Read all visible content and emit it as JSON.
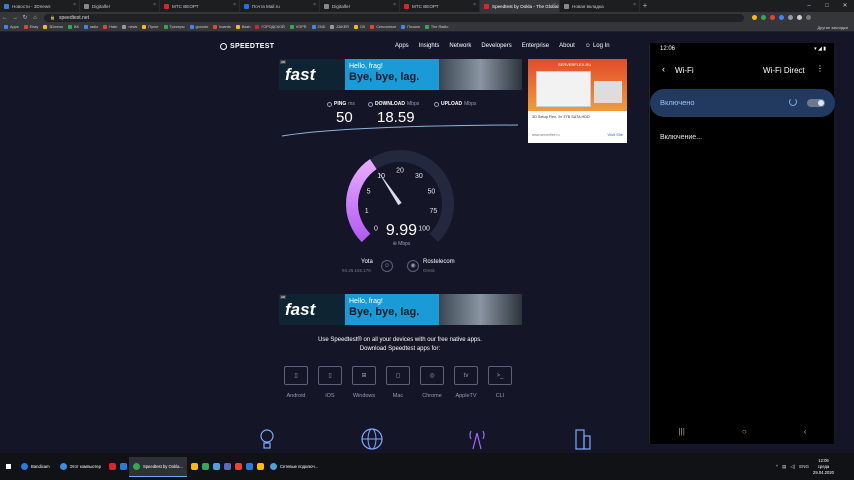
{
  "browser": {
    "tabs": [
      {
        "title": "Новости - 3Dnews",
        "color": "#3a7bd5"
      },
      {
        "title": "Digitalfer",
        "color": "#888888"
      },
      {
        "title": "МТС ВЕОРТ",
        "color": "#d9262c"
      },
      {
        "title": "Почта Mail.ru",
        "color": "#1a73e8"
      },
      {
        "title": "Digitalfer",
        "color": "#888888"
      },
      {
        "title": "МТС ВЕОРТ",
        "color": "#d9262c"
      },
      {
        "title": "Speedtest by Ookla - The Global...",
        "color": "#d9262c",
        "active": true
      },
      {
        "title": "Новая вкладка",
        "color": "#888888"
      }
    ],
    "new_tab": "+",
    "window_controls": [
      "–",
      "□",
      "✕"
    ],
    "url": "speedtest.net",
    "bookmarks": [
      "Apps",
      "Ebay",
      "3Dnews",
      "ВК",
      "radio",
      "Habr",
      "news",
      "Пульт",
      "Трекеры",
      "gooodo",
      "boards",
      "Bash",
      "ГОРОДСКОЙ",
      "VOPR",
      "ZND",
      "ZAKER",
      "ОК",
      "Сенсонные",
      "Почкин",
      "The Radio"
    ],
    "bookmark_colors": [
      "#4285f4",
      "#ea4335",
      "#fbbc05",
      "#34a853",
      "#4285f4",
      "#ea4335",
      "#999999",
      "#fbbc05",
      "#34a853",
      "#4285f4",
      "#ea4335",
      "#fbbc05",
      "#d9262c",
      "#34a853",
      "#4285f4",
      "#999999",
      "#fbbc05",
      "#ea4335",
      "#4285f4",
      "#34a853"
    ],
    "other_bookmarks": "Другие закладки"
  },
  "speedtest": {
    "logo": "SPEEDTEST",
    "nav": [
      "Apps",
      "Insights",
      "Network",
      "Developers",
      "Enterprise",
      "About"
    ],
    "login": "Log In",
    "ad": {
      "tag": "AD",
      "brand": "fast",
      "hello": "Hello, frag!",
      "bye": "Bye, bye, lag."
    },
    "side_ad": {
      "brand": "SERVERFLEX.RU",
      "title": "3D Setup Flex. 2x 3TB SATA HDD",
      "url": "www.serverflex.ru",
      "visit": "Visit Site"
    },
    "ping": {
      "label": "PING",
      "unit": "ms",
      "value": "50"
    },
    "download": {
      "label": "DOWNLOAD",
      "unit": "Mbps",
      "value": "18.59"
    },
    "upload": {
      "label": "UPLOAD",
      "unit": "Mbps",
      "value": ""
    },
    "gauge_labels": [
      "0",
      "1",
      "5",
      "10",
      "20",
      "30",
      "50",
      "75",
      "100"
    ],
    "gauge_value": 9.99,
    "current_speed": "9.99",
    "speed_unit": "Mbps",
    "isp": {
      "name": "Yota",
      "ip": "94.25.165.176"
    },
    "server": {
      "name": "Rostelecom",
      "city": "Omsk"
    },
    "apps_line1": "Use Speedtest® on all your devices with our free native apps.",
    "apps_line2": "Download Speedtest apps for:",
    "apps": [
      "Android",
      "iOS",
      "Windows",
      "Mac",
      "Chrome",
      "AppleTV",
      "CLI"
    ]
  },
  "phone": {
    "time": "12:06",
    "status_right": "▾ ◢ ▮",
    "back": "‹",
    "title": "Wi-Fi",
    "direct": "Wi-Fi Direct",
    "more": "⋮",
    "switch_label": "Включено",
    "state": "Включение...",
    "nav": [
      "|||",
      "○",
      "‹"
    ]
  },
  "taskbar": {
    "items": [
      {
        "title": "Bandicam",
        "color": "#2a7bde"
      },
      {
        "title": "Этот компьютер",
        "color": "#3c90e0"
      },
      {
        "title": "Speedtest by Ookla...",
        "color": "#34a853",
        "active": true
      },
      {
        "title": "Сетевые подключ...",
        "color": "#4aa3df"
      }
    ],
    "icons": [
      "#d9262c",
      "#2a7bde",
      "#fbbc05",
      "#34a853",
      "#4aa3df",
      "#5c6bc0",
      "#ea4335",
      "#2a7bde",
      "#fbbc05"
    ],
    "lang": "ENG",
    "time": "12:06",
    "day": "среда",
    "date": "29.04.2020"
  }
}
